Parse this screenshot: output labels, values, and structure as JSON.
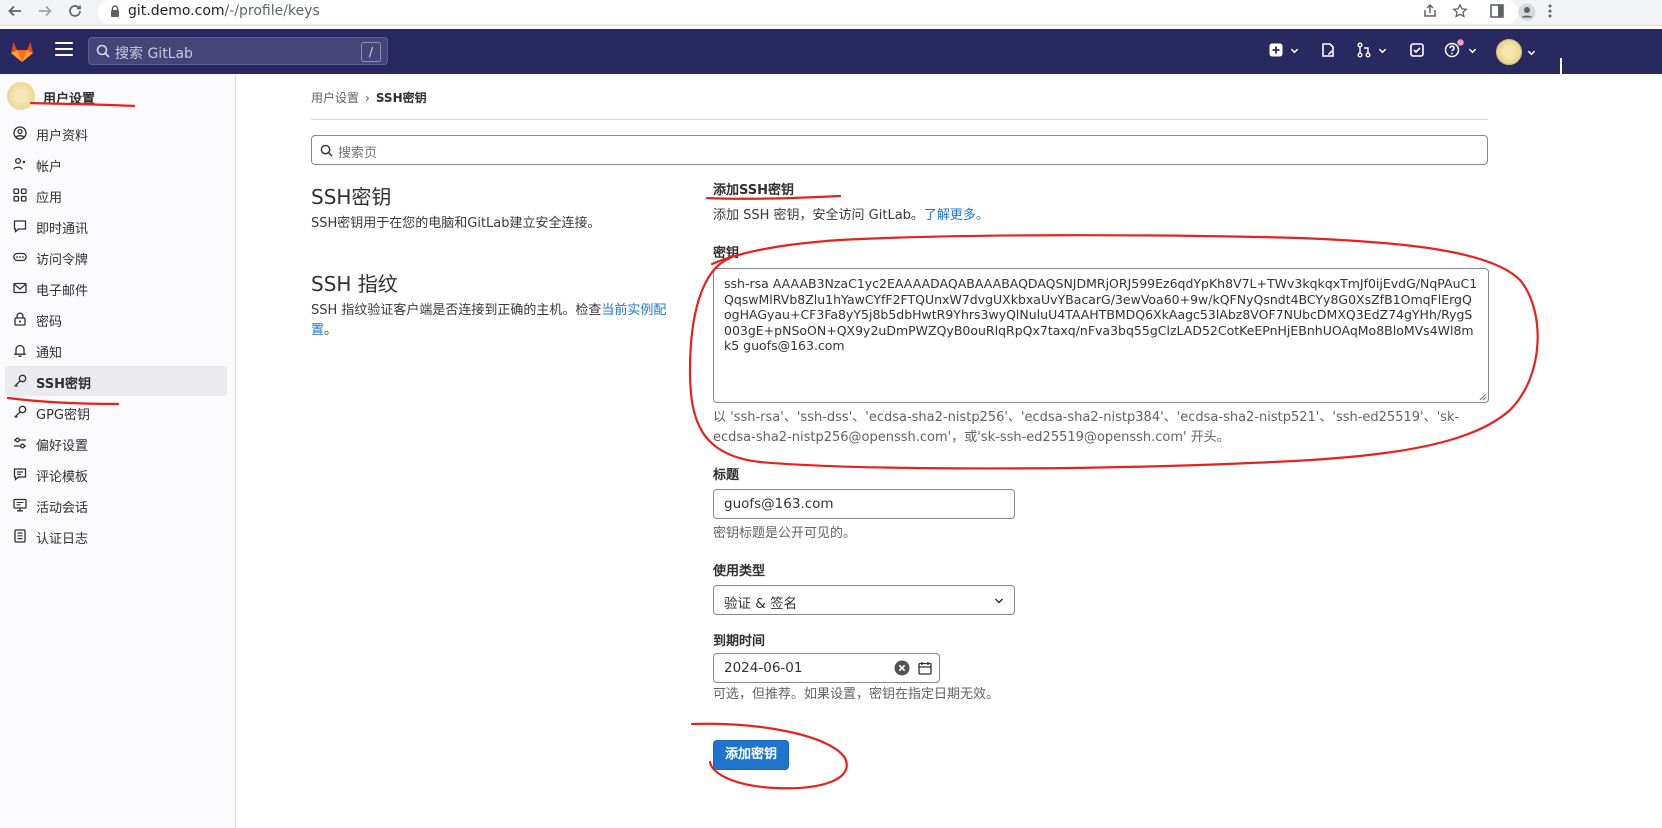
{
  "browser": {
    "url_host": "git.demo.com",
    "url_path": "/-/profile/keys"
  },
  "topbar": {
    "search_placeholder": "搜索 GitLab",
    "search_shortcut": "/"
  },
  "sidebar": {
    "title": "用户设置",
    "items": [
      {
        "label": "用户资料",
        "icon": "profile-icon"
      },
      {
        "label": "帐户",
        "icon": "account-icon"
      },
      {
        "label": "应用",
        "icon": "applications-icon"
      },
      {
        "label": "即时通讯",
        "icon": "chat-icon"
      },
      {
        "label": "访问令牌",
        "icon": "token-icon"
      },
      {
        "label": "电子邮件",
        "icon": "mail-icon"
      },
      {
        "label": "密码",
        "icon": "lock-icon"
      },
      {
        "label": "通知",
        "icon": "notifications-icon"
      },
      {
        "label": "SSH密钥",
        "icon": "key-icon",
        "active": true
      },
      {
        "label": "GPG密钥",
        "icon": "key-icon"
      },
      {
        "label": "偏好设置",
        "icon": "preferences-icon"
      },
      {
        "label": "评论模板",
        "icon": "comment-icon"
      },
      {
        "label": "活动会话",
        "icon": "monitor-icon"
      },
      {
        "label": "认证日志",
        "icon": "log-icon"
      }
    ]
  },
  "breadcrumb": {
    "parent": "用户设置",
    "separator": "›",
    "current": "SSH密钥"
  },
  "page_search": {
    "placeholder": "搜索页"
  },
  "ssh_keys_section": {
    "title": "SSH密钥",
    "description": "SSH密钥用于在您的电脑和GitLab建立安全连接。"
  },
  "fingerprint_section": {
    "title": "SSH 指纹",
    "description": "SSH 指纹验证客户端是否连接到正确的主机。检查",
    "link": "当前实例配置",
    "suffix": "。"
  },
  "form": {
    "heading": "添加SSH密钥",
    "subtext": "添加 SSH 密钥，安全访问 GitLab。",
    "learn_more": "了解更多。",
    "key_label": "密钥",
    "key_value": "ssh-rsa AAAAB3NzaC1yc2EAAAADAQABAAABAQDAQSNJDMRjORJ599Ez6qdYpKh8V7L+TWv3kqkqxTmJf0ijEvdG/NqPAuC1QqswMlRVb8Zlu1hYawCYfF2FTQUnxW7dvgUXkbxaUvYBacarG/3ewVoa60+9w/kQFNyQsndt4BCYy8G0XsZfB1OmqFlErgQogHAGyau+CF3Fa8yY5j8b5dbHwtR9Yhrs3wyQlNuluU4TAAHTBMDQ6XkAagc53lAbz8VOF7NUbcDMXQ3EdZ74gYHh/RygS003gE+pNSoON+QX9y2uDmPWZQyB0ouRlqRpQx7taxq/nFva3bq55gClzLAD52CotKeEPnHjEBnhUOAqMo8BloMVs4Wl8mk5 guofs@163.com",
    "key_help": "以 'ssh-rsa'、'ssh-dss'、'ecdsa-sha2-nistp256'、'ecdsa-sha2-nistp384'、'ecdsa-sha2-nistp521'、'ssh-ed25519'、'sk-ecdsa-sha2-nistp256@openssh.com'，或'sk-ssh-ed25519@openssh.com' 开头。",
    "title_label": "标题",
    "title_value": "guofs@163.com",
    "title_help": "密钥标题是公开可见的。",
    "usage_label": "使用类型",
    "usage_value": "验证 & 签名",
    "expires_label": "到期时间",
    "expires_value": "2024-06-01",
    "expires_help": "可选，但推荐。如果设置，密钥在指定日期无效。",
    "submit_label": "添加密钥"
  },
  "colors": {
    "topbar_bg": "#292961",
    "primary_button": "#1f75cb",
    "annotation_red": "#e8211c"
  }
}
